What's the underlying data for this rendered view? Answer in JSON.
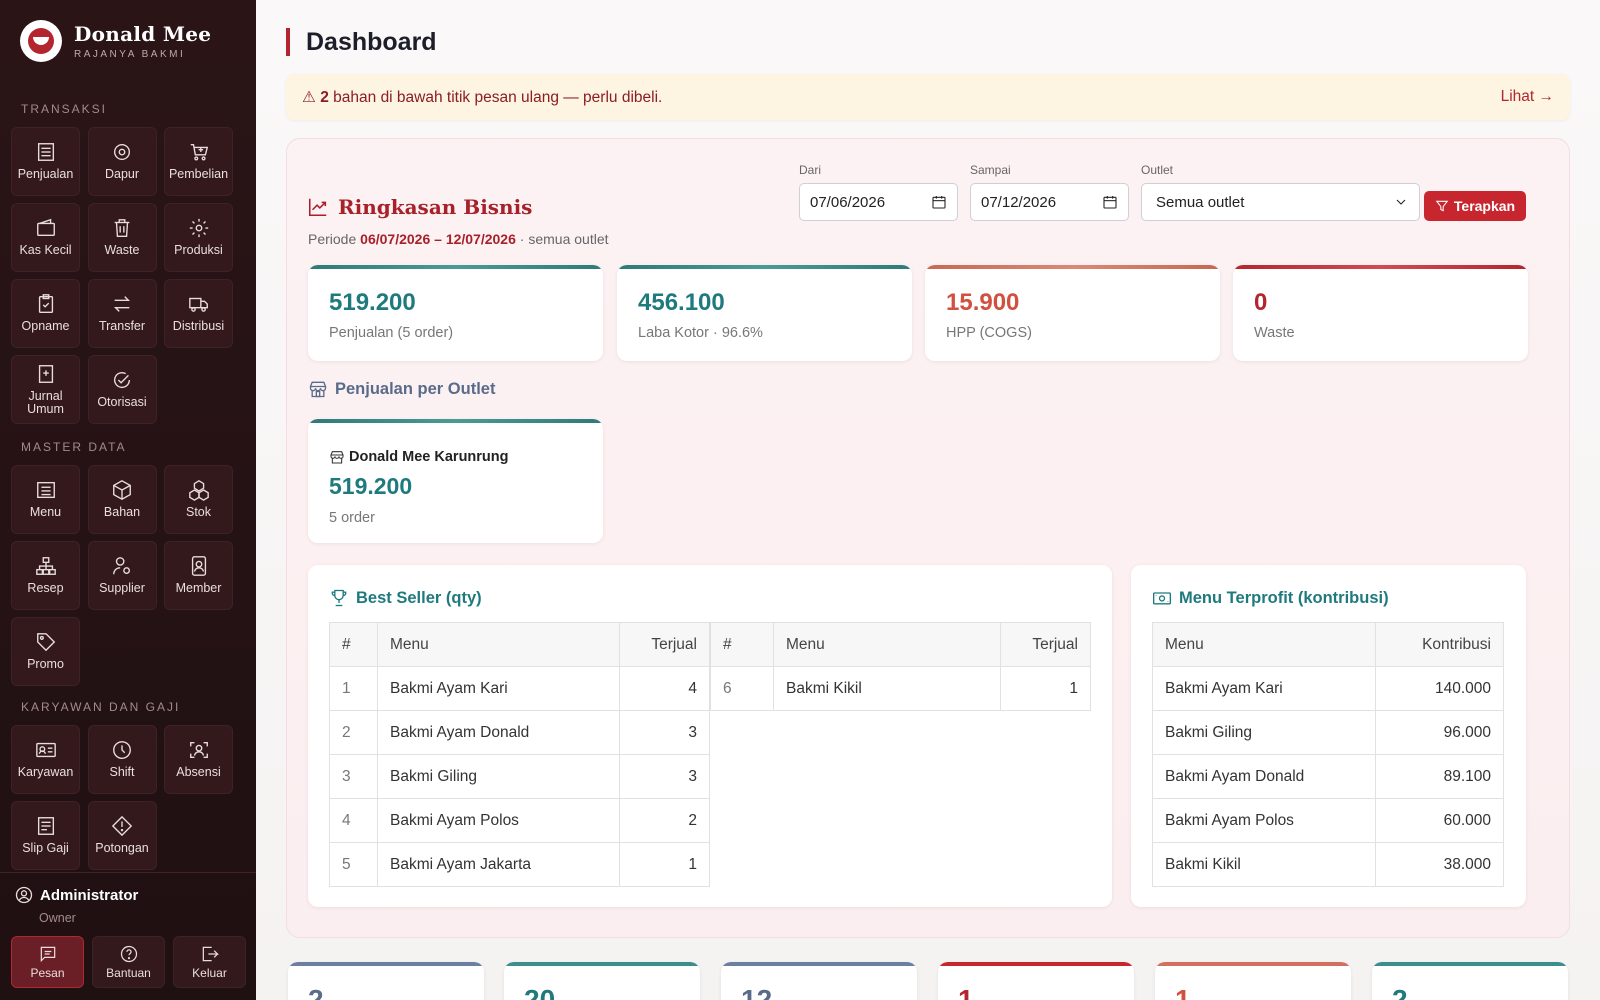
{
  "brand": {
    "name": "Donald Mee",
    "tagline": "RAJANYA BAKMI"
  },
  "sidebar": {
    "sections": [
      {
        "title": "TRANSAKSI",
        "items": [
          {
            "label": "Penjualan",
            "icon": "receipt-icon"
          },
          {
            "label": "Dapur",
            "icon": "frying-pan-icon"
          },
          {
            "label": "Pembelian",
            "icon": "cart-icon"
          },
          {
            "label": "Kas Kecil",
            "icon": "wallet-icon"
          },
          {
            "label": "Waste",
            "icon": "trash-icon"
          },
          {
            "label": "Produksi",
            "icon": "gear-icon"
          },
          {
            "label": "Opname",
            "icon": "clipboard-check-icon"
          },
          {
            "label": "Transfer",
            "icon": "arrows-swap-icon"
          },
          {
            "label": "Distribusi",
            "icon": "truck-icon"
          },
          {
            "label": "Jurnal Umum",
            "icon": "journal-plus-icon"
          },
          {
            "label": "Otorisasi",
            "icon": "check-circle-icon"
          }
        ]
      },
      {
        "title": "MASTER DATA",
        "items": [
          {
            "label": "Menu",
            "icon": "list-icon"
          },
          {
            "label": "Bahan",
            "icon": "box-icon"
          },
          {
            "label": "Stok",
            "icon": "boxes-icon"
          },
          {
            "label": "Resep",
            "icon": "diagram-icon"
          },
          {
            "label": "Supplier",
            "icon": "person-gear-icon"
          },
          {
            "label": "Member",
            "icon": "member-card-icon"
          },
          {
            "label": "Promo",
            "icon": "tag-icon"
          }
        ]
      },
      {
        "title": "KARYAWAN DAN GAJI",
        "items": [
          {
            "label": "Karyawan",
            "icon": "id-card-icon"
          },
          {
            "label": "Shift",
            "icon": "clock-icon"
          },
          {
            "label": "Absensi",
            "icon": "person-badge-icon"
          },
          {
            "label": "Slip Gaji",
            "icon": "payslip-icon"
          },
          {
            "label": "Potongan",
            "icon": "warning-diamond-icon"
          }
        ]
      }
    ]
  },
  "user": {
    "name": "Administrator",
    "role": "Owner"
  },
  "bottom_actions": [
    {
      "label": "Pesan",
      "icon": "message-icon",
      "active": true
    },
    {
      "label": "Bantuan",
      "icon": "help-icon",
      "active": false
    },
    {
      "label": "Keluar",
      "icon": "logout-icon",
      "active": false
    }
  ],
  "page": {
    "title": "Dashboard"
  },
  "alert": {
    "icon": "⚠",
    "count": "2",
    "text": "bahan di bawah titik pesan ulang — perlu dibeli.",
    "link": "Lihat →"
  },
  "summary": {
    "title": "Ringkasan Bisnis",
    "period_prefix": "Periode",
    "period_start": "06/07/2026",
    "period_sep": "–",
    "period_end": "12/07/2026",
    "period_suffix": "· semua outlet"
  },
  "filters": {
    "from_label": "Dari",
    "from_value": "07/06/2026",
    "to_label": "Sampai",
    "to_value": "07/12/2026",
    "outlet_label": "Outlet",
    "outlet_value": "Semua outlet",
    "apply_label": "Terapkan"
  },
  "stats": [
    {
      "value": "519.200",
      "label": "Penjualan (5 order)",
      "color": "#1f7a7e",
      "bar": "#3c8e8c"
    },
    {
      "value": "456.100",
      "label": "Laba Kotor · 96.6%",
      "color": "#1f7a7e",
      "bar": "#3c8e8c"
    },
    {
      "value": "15.900",
      "label": "HPP (COGS)",
      "color": "#d1503e",
      "bar": "#d27060"
    },
    {
      "value": "0",
      "label": "Waste",
      "color": "#b3262f",
      "bar": "#c8262f"
    }
  ],
  "outlet_section": {
    "title": "Penjualan per Outlet",
    "outlets": [
      {
        "name": "Donald Mee Karunrung",
        "value": "519.200",
        "orders": "5 order"
      }
    ]
  },
  "best_seller": {
    "title": "Best Seller (qty)",
    "headers": [
      "#",
      "Menu",
      "Terjual"
    ],
    "rows": [
      {
        "rank": "1",
        "menu": "Bakmi Ayam Kari",
        "sold": "4"
      },
      {
        "rank": "2",
        "menu": "Bakmi Ayam Donald",
        "sold": "3"
      },
      {
        "rank": "3",
        "menu": "Bakmi Giling",
        "sold": "3"
      },
      {
        "rank": "4",
        "menu": "Bakmi Ayam Polos",
        "sold": "2"
      },
      {
        "rank": "5",
        "menu": "Bakmi Ayam Jakarta",
        "sold": "1"
      },
      {
        "rank": "6",
        "menu": "Bakmi Kikil",
        "sold": "1"
      }
    ]
  },
  "profit_menu": {
    "title": "Menu Terprofit (kontribusi)",
    "headers": [
      "Menu",
      "Kontribusi"
    ],
    "rows": [
      {
        "menu": "Bakmi Ayam Kari",
        "value": "140.000"
      },
      {
        "menu": "Bakmi Giling",
        "value": "96.000"
      },
      {
        "menu": "Bakmi Ayam Donald",
        "value": "89.100"
      },
      {
        "menu": "Bakmi Ayam Polos",
        "value": "60.000"
      },
      {
        "menu": "Bakmi Kikil",
        "value": "38.000"
      }
    ]
  },
  "bottom_stats": [
    {
      "value": "2",
      "color": "#5a6b8a",
      "bar": "#6d7fa0"
    },
    {
      "value": "20",
      "color": "#1f7a7e",
      "bar": "#3c8e8c"
    },
    {
      "value": "12",
      "color": "#5a6b8a",
      "bar": "#6d7fa0"
    },
    {
      "value": "1",
      "color": "#b3262f",
      "bar": "#c8262f"
    },
    {
      "value": "1",
      "color": "#d1503e",
      "bar": "#d27060"
    },
    {
      "value": "2",
      "color": "#1f7a7e",
      "bar": "#3c8e8c"
    }
  ]
}
